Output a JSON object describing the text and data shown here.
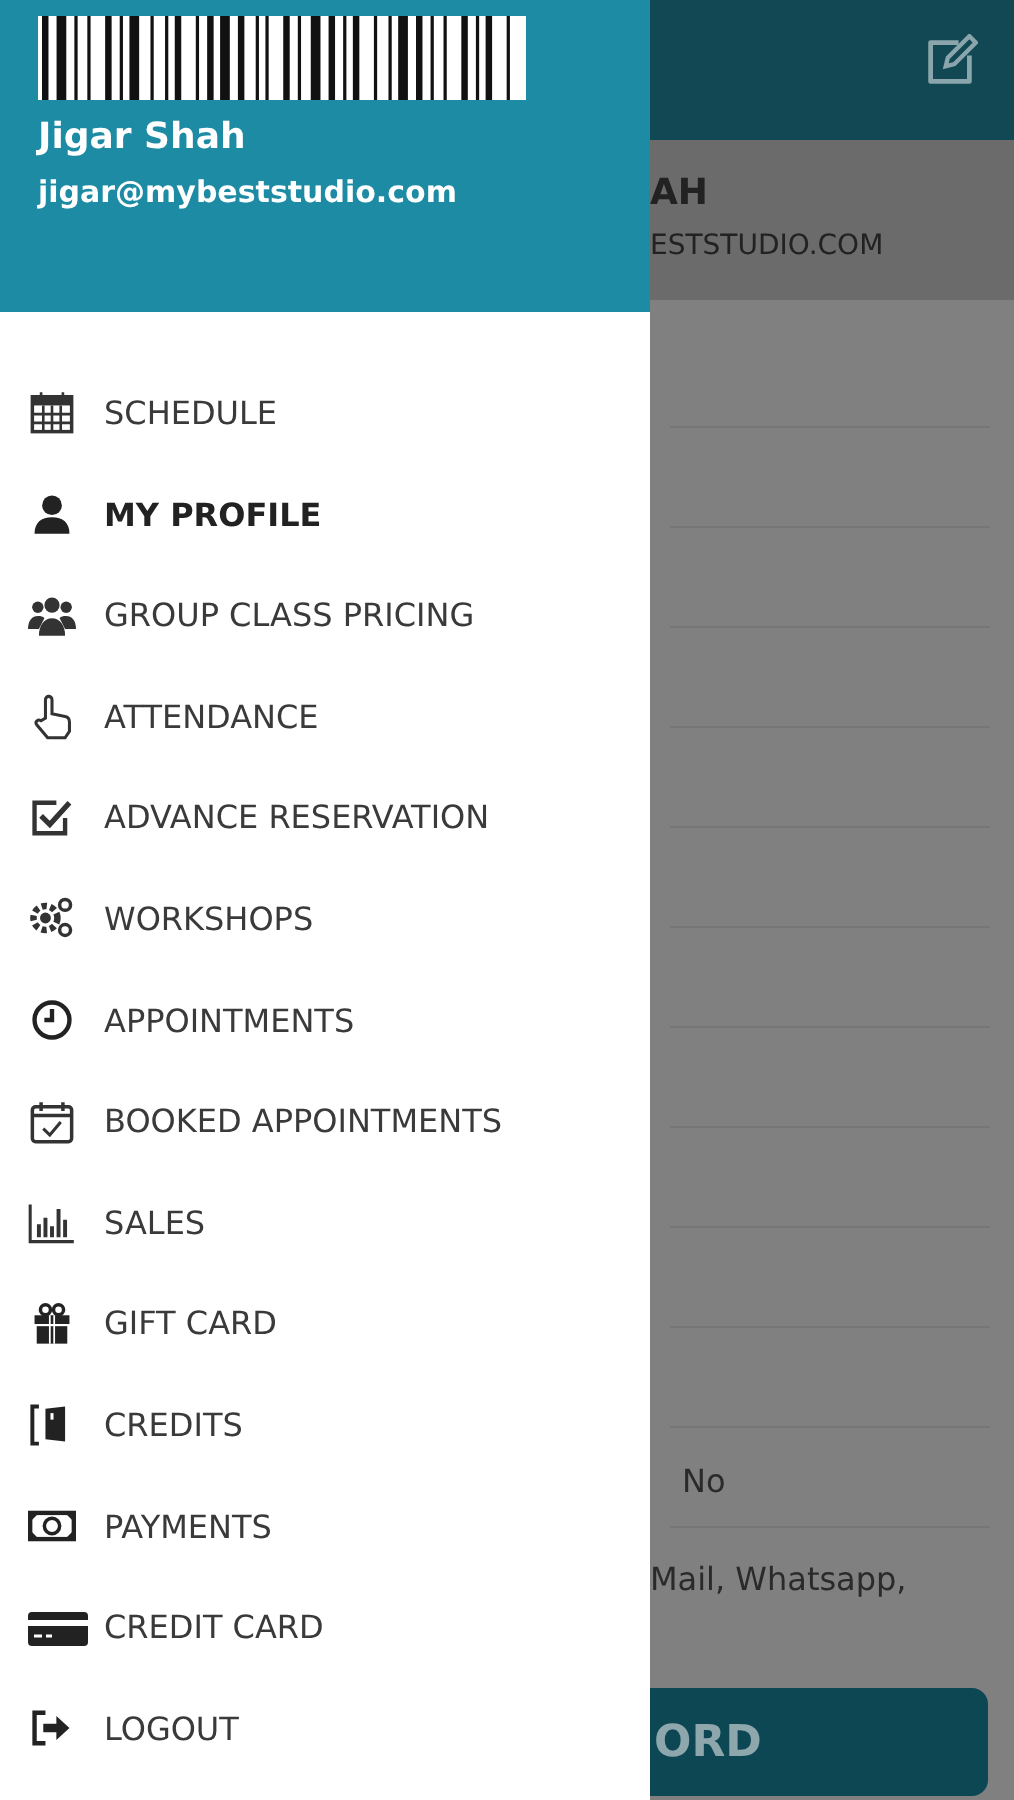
{
  "drawer": {
    "user_name": "Jigar Shah",
    "user_email": "jigar@mybeststudio.com",
    "menu": [
      {
        "label": "SCHEDULE",
        "selected": false
      },
      {
        "label": "MY PROFILE",
        "selected": true
      },
      {
        "label": "GROUP CLASS PRICING",
        "selected": false
      },
      {
        "label": "ATTENDANCE",
        "selected": false
      },
      {
        "label": "ADVANCE RESERVATION",
        "selected": false
      },
      {
        "label": "WORKSHOPS",
        "selected": false
      },
      {
        "label": "APPOINTMENTS",
        "selected": false
      },
      {
        "label": "BOOKED APPOINTMENTS",
        "selected": false
      },
      {
        "label": "SALES",
        "selected": false
      },
      {
        "label": "GIFT CARD",
        "selected": false
      },
      {
        "label": "CREDITS",
        "selected": false
      },
      {
        "label": "PAYMENTS",
        "selected": false
      },
      {
        "label": "CREDIT CARD",
        "selected": false
      },
      {
        "label": "LOGOUT",
        "selected": false
      }
    ]
  },
  "background_screen": {
    "profile_name": "AH",
    "profile_email": "ESTSTUDIO.COM",
    "rows": [
      {
        "value": "No"
      },
      {
        "value": "Mail, Whatsapp,"
      }
    ],
    "button": "ORD"
  }
}
